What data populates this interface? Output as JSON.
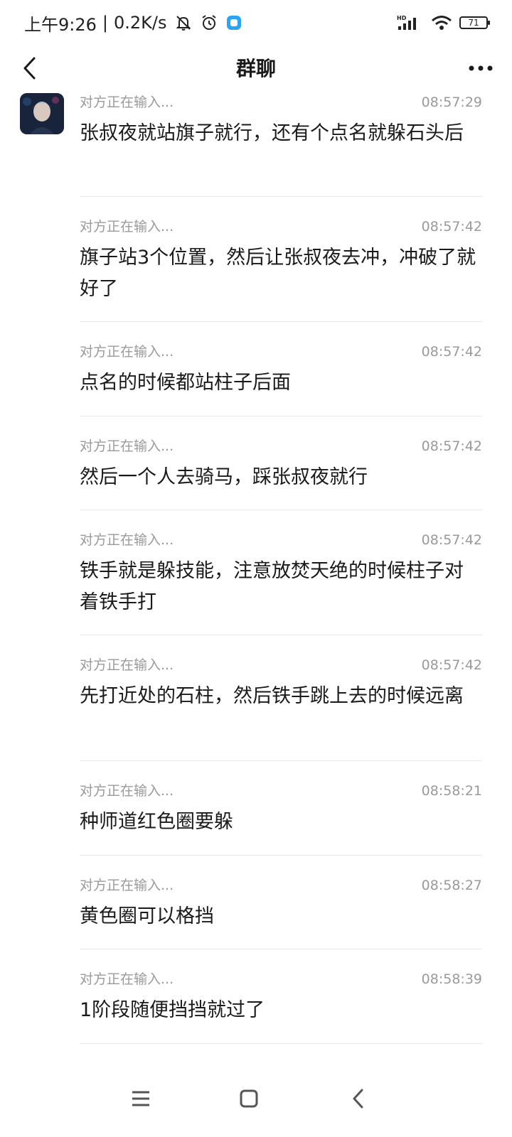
{
  "status_bar": {
    "time": "上午9:26",
    "separator": "|",
    "speed": "0.2K/s",
    "signal_label": "HD",
    "battery": "71",
    "icons": [
      "mute-bell-icon",
      "alarm-icon",
      "app-notification-icon",
      "hd-signal-icon",
      "wifi-icon",
      "battery-icon"
    ]
  },
  "header": {
    "title": "群聊",
    "back_icon": "chevron-left-icon",
    "more_icon": "more-dots-icon"
  },
  "messages": [
    {
      "status": "对方正在输入...",
      "time": "08:57:29",
      "text": "张叔夜就站旗子就行，还有个点名就躲石头后"
    },
    {
      "status": "对方正在输入...",
      "time": "08:57:42",
      "text": "旗子站3个位置，然后让张叔夜去冲，冲破了就好了"
    },
    {
      "status": "对方正在输入...",
      "time": "08:57:42",
      "text": "点名的时候都站柱子后面"
    },
    {
      "status": "对方正在输入...",
      "time": "08:57:42",
      "text": "然后一个人去骑马，踩张叔夜就行"
    },
    {
      "status": "对方正在输入...",
      "time": "08:57:42",
      "text": "铁手就是躲技能，注意放焚天绝的时候柱子对着铁手打"
    },
    {
      "status": "对方正在输入...",
      "time": "08:57:42",
      "text": "先打近处的石柱，然后铁手跳上去的时候远离"
    },
    {
      "status": "对方正在输入...",
      "time": "08:58:21",
      "text": "种师道红色圈要躲"
    },
    {
      "status": "对方正在输入...",
      "time": "08:58:27",
      "text": "黄色圈可以格挡"
    },
    {
      "status": "对方正在输入...",
      "time": "08:58:39",
      "text": "1阶段随便挡挡就过了"
    }
  ],
  "nav_bar": {
    "icons": [
      "menu-icon",
      "home-icon",
      "back-icon"
    ]
  }
}
